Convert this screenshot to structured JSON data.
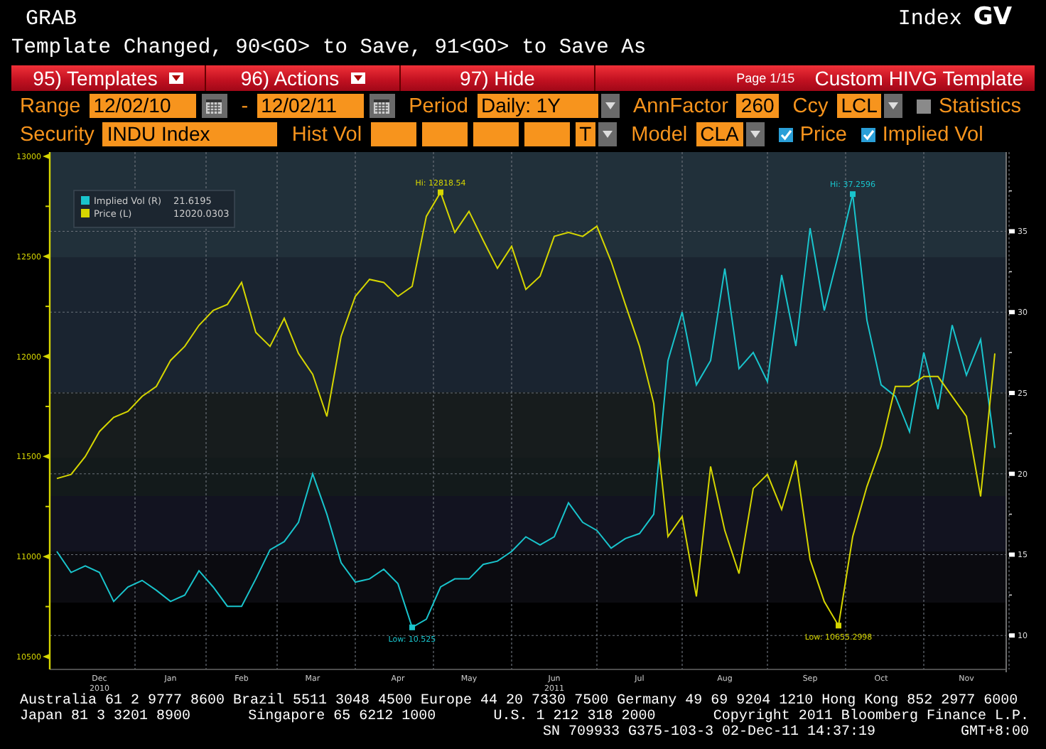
{
  "header": {
    "screen": "GRAB",
    "message": "Template Changed, 90<GO> to Save, 91<GO> to Save As",
    "security_type": "Index",
    "function": "GV"
  },
  "toolbar": {
    "menus": [
      {
        "label": "95) Templates",
        "caret": true
      },
      {
        "label": "96) Actions",
        "caret": true
      },
      {
        "label": "97) Hide",
        "caret": false
      }
    ],
    "page": "Page 1/15",
    "template": "Custom HIVG Template"
  },
  "controls": [
    [
      {
        "kind": "label",
        "text": "Range"
      },
      {
        "kind": "date",
        "value": "12/02/10"
      },
      {
        "kind": "calendar"
      },
      {
        "kind": "dash",
        "text": "-"
      },
      {
        "kind": "date",
        "value": "12/02/11"
      },
      {
        "kind": "calendar"
      },
      {
        "kind": "label",
        "text": "Period"
      },
      {
        "kind": "select",
        "value": "Daily: 1Y"
      },
      {
        "kind": "label",
        "text": "AnnFactor"
      },
      {
        "kind": "input",
        "value": "260"
      },
      {
        "kind": "label",
        "text": "Ccy"
      },
      {
        "kind": "select",
        "value": "LCL"
      },
      {
        "kind": "checkbox",
        "label": "Statistics",
        "checked": false
      }
    ],
    [
      {
        "kind": "label",
        "text": "Security"
      },
      {
        "kind": "input",
        "value": "INDU Index"
      },
      {
        "kind": "label",
        "text": "Hist Vol"
      },
      {
        "kind": "input"
      },
      {
        "kind": "input"
      },
      {
        "kind": "input"
      },
      {
        "kind": "input"
      },
      {
        "kind": "select",
        "value": "T"
      },
      {
        "kind": "label",
        "text": "Model"
      },
      {
        "kind": "select",
        "value": "CLA"
      },
      {
        "kind": "checkbox",
        "label": "Price",
        "checked": true
      },
      {
        "kind": "checkbox",
        "label": "Implied Vol",
        "checked": true
      }
    ]
  ],
  "chart": {
    "chart_data": {
      "type": "line",
      "categories": [
        null,
        null,
        null,
        "Dec\n2010",
        null,
        null,
        null,
        null,
        "Jan",
        null,
        null,
        null,
        null,
        "Feb",
        null,
        null,
        null,
        null,
        "Mar",
        null,
        null,
        null,
        null,
        null,
        "Apr",
        null,
        null,
        null,
        null,
        "May",
        null,
        null,
        null,
        null,
        null,
        "Jun\n2011",
        null,
        null,
        null,
        null,
        null,
        "Jul",
        null,
        null,
        null,
        null,
        null,
        "Aug",
        null,
        null,
        null,
        null,
        null,
        "Sep",
        null,
        null,
        null,
        null,
        "Oct",
        null,
        null,
        null,
        null,
        null,
        "Nov",
        null,
        null
      ],
      "ylim": [
        10436,
        13021
      ],
      "y2lim": [
        7.9,
        39.9
      ],
      "grid": true,
      "legend": "upper left",
      "yticks": [
        {
          "value": 10500,
          "label": "10500"
        },
        {
          "value": 11000,
          "label": "11000"
        },
        {
          "value": 11500,
          "label": "11500"
        },
        {
          "value": 12000,
          "label": "12000"
        },
        {
          "value": 12500,
          "label": "12500"
        },
        {
          "value": 13000,
          "label": "13000"
        }
      ],
      "y2ticks": [
        {
          "value": 10,
          "label": "10"
        },
        {
          "value": 15,
          "label": "15"
        },
        {
          "value": 20,
          "label": "20"
        },
        {
          "value": 25,
          "label": "25"
        },
        {
          "value": 30,
          "label": "30"
        },
        {
          "value": 35,
          "label": "35"
        }
      ],
      "series": [
        {
          "name": "Implied Vol (R)",
          "axis": "y2",
          "color": "#19c4cc",
          "values": [
            15.2,
            13.9,
            14.3,
            13.9,
            12.1,
            13.0,
            13.4,
            12.8,
            12.1,
            12.5,
            14.0,
            13.0,
            11.8,
            11.8,
            13.5,
            15.3,
            15.8,
            17.0,
            20.0,
            17.5,
            14.5,
            13.3,
            13.5,
            14.1,
            13.2,
            10.5,
            11.0,
            13.0,
            13.5,
            13.5,
            14.4,
            14.6,
            15.2,
            16.1,
            15.6,
            16.1,
            18.2,
            17.0,
            16.5,
            15.4,
            16.0,
            16.3,
            17.5,
            27.0,
            30.0,
            25.5,
            27.0,
            32.7,
            26.5,
            27.5,
            25.7,
            32.3,
            27.9,
            35.2,
            30.1,
            33.6,
            37.3,
            29.5,
            25.5,
            24.8,
            22.6,
            27.5,
            24.0,
            29.2,
            26.1,
            28.3,
            21.6
          ]
        },
        {
          "name": "Price (L)",
          "color": "#d6d600",
          "values": [
            11390,
            11410,
            11500,
            11625,
            11695,
            11725,
            11800,
            11850,
            11980,
            12050,
            12155,
            12230,
            12260,
            12370,
            12120,
            12050,
            12190,
            12015,
            11910,
            11700,
            12100,
            12300,
            12385,
            12370,
            12300,
            12350,
            12700,
            12820,
            12620,
            12725,
            12580,
            12440,
            12550,
            12335,
            12400,
            12600,
            12620,
            12600,
            12650,
            12475,
            12260,
            12050,
            11765,
            11100,
            11200,
            10800,
            11450,
            11130,
            10915,
            11340,
            11410,
            11235,
            11480,
            10985,
            10775,
            10655,
            11100,
            11350,
            11550,
            11850,
            11850,
            11900,
            11900,
            11800,
            11700,
            11300,
            12015
          ]
        }
      ]
    },
    "legend_values": [
      {
        "value": "21.6195"
      },
      {
        "value": "12020.0303"
      }
    ],
    "extremes": [
      {
        "kind": "high-y",
        "text": "Hi: 12818.54"
      },
      {
        "kind": "high-y2",
        "text": "Hi: 37.2596"
      },
      {
        "kind": "low-y2",
        "text": "Low: 10.525"
      },
      {
        "kind": "low-y",
        "text": "Low: 10655.2998"
      }
    ]
  },
  "footer": [
    [
      "Australia 61 2 9777 8600 Brazil 5511 3048 4500 Europe 44 20 7330 7500 Germany 49 69 9204 1210 Hong Kong 852 2977 6000"
    ],
    [
      "Japan 81 3 3201 8900",
      "Singapore 65 6212 1000",
      "U.S. 1 212 318 2000",
      "Copyright 2011 Bloomberg Finance L.P."
    ],
    [
      "SN 709933 G375-103-3 02-Dec-11 14:37:19",
      "GMT+8:00"
    ]
  ]
}
